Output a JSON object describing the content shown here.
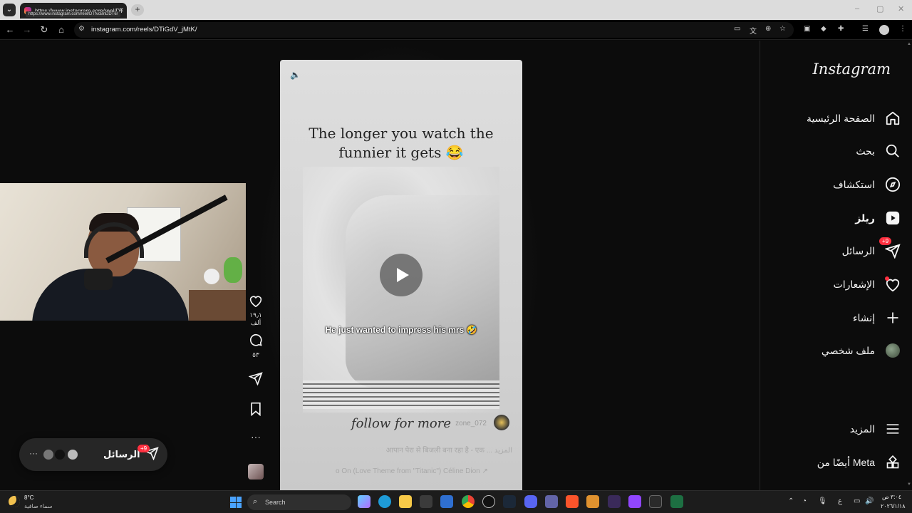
{
  "browser": {
    "tab_title": "https://www.instagram.com/reel/DTfvcBnDDT6/",
    "tab_tooltip": "https://www.instagram.com/reel/DTfvcBnDDT6/",
    "url": "instagram.com/reels/DTiGdV_jMtK/"
  },
  "sidebar": {
    "logo": "Instagram",
    "items": [
      {
        "label": "الصفحة الرئيسية",
        "icon": "home-icon"
      },
      {
        "label": "بحث",
        "icon": "search-icon"
      },
      {
        "label": "استكشاف",
        "icon": "compass-icon"
      },
      {
        "label": "ريلز",
        "icon": "reels-icon"
      },
      {
        "label": "الرسائل",
        "icon": "messenger-icon",
        "badge": "+9"
      },
      {
        "label": "الإشعارات",
        "icon": "heart-icon"
      },
      {
        "label": "إنشاء",
        "icon": "plus-icon"
      },
      {
        "label": "ملف شخصي",
        "icon": "profile-avatar"
      },
      {
        "label": "المزيد",
        "icon": "menu-icon"
      },
      {
        "label": "أيضًا من Meta",
        "icon": "grid-icon"
      }
    ]
  },
  "reel": {
    "headline_line1": "The longer you watch the",
    "headline_line2": "funnier it gets 😂",
    "video_caption": "He just wanted to impress his mrs 🤣",
    "overlay_text": "follow for more",
    "author": "zone_072",
    "description": "आपान पेरा से बिजली बना रहा है - एक ... المزيد",
    "music": "o On (Love Theme from \"Titanic\")  Céline Dion  ↗"
  },
  "actions": {
    "likes": "١٩٫١ ألف",
    "comments": "٥٣"
  },
  "messages_pill": {
    "label": "الرسائل",
    "badge": "+9"
  },
  "taskbar": {
    "weather_temp": "8°C",
    "weather_desc": "سماء صافية",
    "search_placeholder": "Search",
    "time": "٣:٠٤ ص",
    "date": "٢٠٢٦/١/١٨",
    "lang": "ع"
  }
}
